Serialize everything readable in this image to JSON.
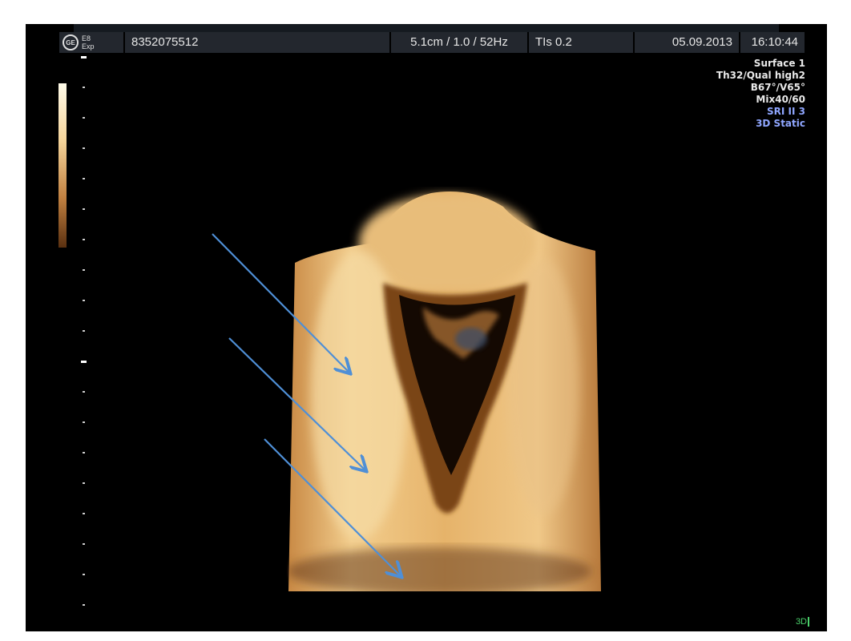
{
  "header": {
    "logo_text": "GE",
    "probe": "E8",
    "mode": "Exp",
    "patient_id": "8352075512",
    "params": "5.1cm / 1.0 / 52Hz",
    "tis": "TIs 0.2",
    "date": "05.09.2013",
    "time": "16:10:44"
  },
  "info_panel": {
    "lines": [
      "Surface 1",
      "Th32/Qual high2",
      "B67°/V65°",
      "Mix40/60"
    ],
    "blue_lines": [
      "SRI II 3",
      "3D Static"
    ]
  },
  "mode_badge": "3D",
  "colors": {
    "arrow": "#4f8fd6",
    "tissue": "#e8b46a",
    "background": "#000000"
  },
  "annotations": {
    "arrow_count": 3
  }
}
